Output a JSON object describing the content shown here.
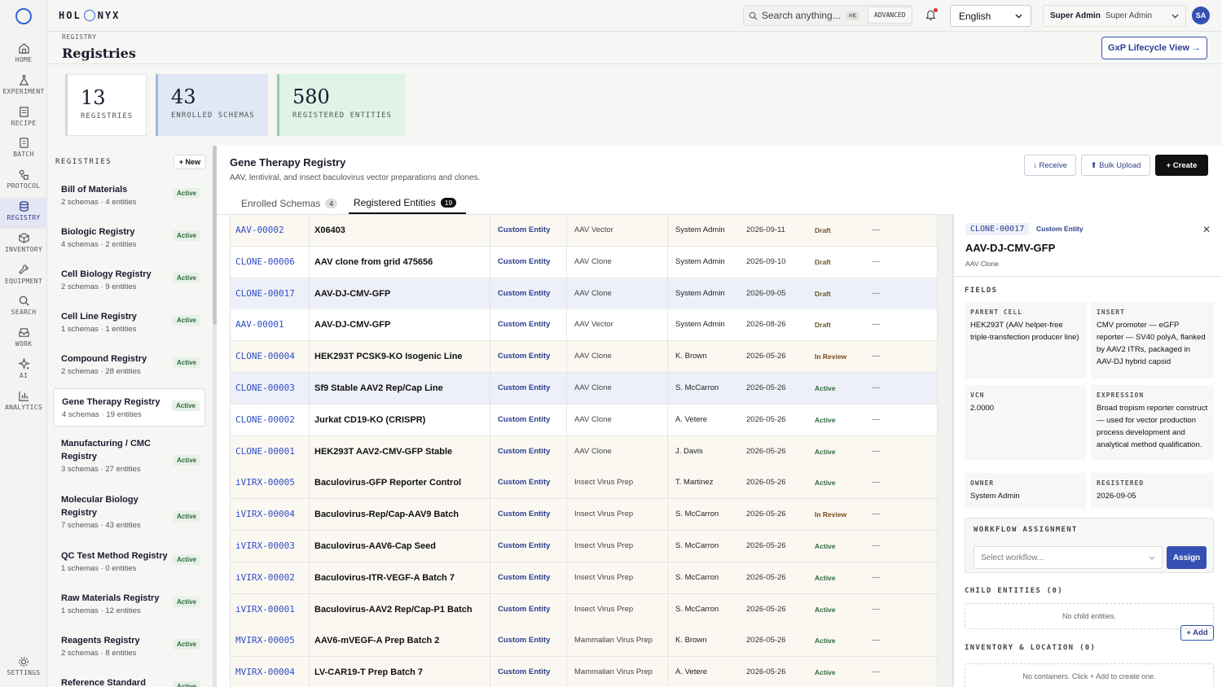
{
  "brand": {
    "left": "HOL",
    "right": "NYX"
  },
  "nav": [
    {
      "key": "home",
      "label": "HOME"
    },
    {
      "key": "experiment",
      "label": "EXPERIMENT"
    },
    {
      "key": "recipe",
      "label": "RECIPE"
    },
    {
      "key": "batch",
      "label": "BATCH"
    },
    {
      "key": "protocol",
      "label": "PROTOCOL"
    },
    {
      "key": "registry",
      "label": "REGISTRY"
    },
    {
      "key": "inventory",
      "label": "INVENTORY"
    },
    {
      "key": "equipment",
      "label": "EQUIPMENT"
    },
    {
      "key": "search",
      "label": "SEARCH"
    },
    {
      "key": "work",
      "label": "WORK"
    },
    {
      "key": "ai",
      "label": "AI"
    },
    {
      "key": "analytics",
      "label": "ANALYTICS"
    }
  ],
  "nav_settings": "SETTINGS",
  "topbar": {
    "search_placeholder": "Search anything...",
    "search_kbd": "⌘K",
    "advanced": "ADVANCED",
    "language": "English",
    "role_label": "Super Admin",
    "role_value": "Super Admin",
    "avatar": "SA"
  },
  "header": {
    "breadcrumb": "REGISTRY",
    "title": "Registries",
    "gxp_button": "GxP Lifecycle View →"
  },
  "stats": [
    {
      "value": "13",
      "label": "REGISTRIES"
    },
    {
      "value": "43",
      "label": "ENROLLED SCHEMAS"
    },
    {
      "value": "580",
      "label": "REGISTERED ENTITIES"
    }
  ],
  "registries": {
    "heading": "REGISTRIES",
    "new_button": "+ New",
    "items": [
      {
        "name": "Bill of Materials",
        "meta": "2 schemas · 4 entities",
        "status": "Active"
      },
      {
        "name": "Biologic Registry",
        "meta": "4 schemas · 2 entities",
        "status": "Active"
      },
      {
        "name": "Cell Biology Registry",
        "meta": "2 schemas · 9 entities",
        "status": "Active"
      },
      {
        "name": "Cell Line Registry",
        "meta": "1 schemas · 1 entities",
        "status": "Active"
      },
      {
        "name": "Compound Registry",
        "meta": "2 schemas · 28 entities",
        "status": "Active"
      },
      {
        "name": "Gene Therapy Registry",
        "meta": "4 schemas · 19 entities",
        "status": "Active"
      },
      {
        "name": "Manufacturing / CMC Registry",
        "meta": "3 schemas · 27 entities",
        "status": "Active"
      },
      {
        "name": "Molecular Biology Registry",
        "meta": "7 schemas · 43 entities",
        "status": "Active"
      },
      {
        "name": "QC Test Method Registry",
        "meta": "1 schemas · 0 entities",
        "status": "Active"
      },
      {
        "name": "Raw Materials Registry",
        "meta": "1 schemas · 12 entities",
        "status": "Active"
      },
      {
        "name": "Reagents Registry",
        "meta": "2 schemas · 8 entities",
        "status": "Active"
      },
      {
        "name": "Reference Standard",
        "meta": "",
        "status": "Active"
      }
    ]
  },
  "registry": {
    "title": "Gene Therapy Registry",
    "description": "AAV, lentiviral, and insect baculovirus vector preparations and clones.",
    "receive": "↓ Receive",
    "bulk_upload": "⬆ Bulk Upload",
    "create": "+ Create",
    "tabs": [
      {
        "label": "Enrolled Schemas",
        "count": "4"
      },
      {
        "label": "Registered Entities",
        "count": "19"
      }
    ]
  },
  "entities": [
    {
      "id": "AAV-00002",
      "name": "X06403",
      "type": "Custom Entity",
      "schema": "AAV Vector",
      "owner": "System Admin",
      "date": "2026-09-11",
      "status": "Draft",
      "extra": "—"
    },
    {
      "id": "CLONE-00006",
      "name": "AAV clone from grid 475656",
      "type": "Custom Entity",
      "schema": "AAV Clone",
      "owner": "System Admin",
      "date": "2026-09-10",
      "status": "Draft",
      "extra": "—"
    },
    {
      "id": "CLONE-00017",
      "name": "AAV-DJ-CMV-GFP",
      "type": "Custom Entity",
      "schema": "AAV Clone",
      "owner": "System Admin",
      "date": "2026-09-05",
      "status": "Draft",
      "extra": "—"
    },
    {
      "id": "AAV-00001",
      "name": "AAV-DJ-CMV-GFP",
      "type": "Custom Entity",
      "schema": "AAV Vector",
      "owner": "System Admin",
      "date": "2026-08-26",
      "status": "Draft",
      "extra": "—"
    },
    {
      "id": "CLONE-00004",
      "name": "HEK293T PCSK9-KO Isogenic Line",
      "type": "Custom Entity",
      "schema": "AAV Clone",
      "owner": "K. Brown",
      "date": "2026-05-26",
      "status": "In Review",
      "extra": "—"
    },
    {
      "id": "CLONE-00003",
      "name": "Sf9 Stable AAV2 Rep/Cap Line",
      "type": "Custom Entity",
      "schema": "AAV Clone",
      "owner": "S. McCarron",
      "date": "2026-05-26",
      "status": "Active",
      "extra": "—"
    },
    {
      "id": "CLONE-00002",
      "name": "Jurkat CD19-KO (CRISPR)",
      "type": "Custom Entity",
      "schema": "AAV Clone",
      "owner": "A. Vetere",
      "date": "2026-05-26",
      "status": "Active",
      "extra": "—"
    },
    {
      "id": "CLONE-00001",
      "name": "HEK293T AAV2-CMV-GFP Stable",
      "type": "Custom Entity",
      "schema": "AAV Clone",
      "owner": "J. Davis",
      "date": "2026-05-26",
      "status": "Active",
      "extra": "—"
    },
    {
      "id": "iVIRX-00005",
      "name": "Baculovirus-GFP Reporter Control",
      "type": "Custom Entity",
      "schema": "Insect Virus Prep",
      "owner": "T. Martinez",
      "date": "2026-05-26",
      "status": "Active",
      "extra": "—"
    },
    {
      "id": "iVIRX-00004",
      "name": "Baculovirus-Rep/Cap-AAV9 Batch",
      "type": "Custom Entity",
      "schema": "Insect Virus Prep",
      "owner": "S. McCarron",
      "date": "2026-05-26",
      "status": "In Review",
      "extra": "—"
    },
    {
      "id": "iVIRX-00003",
      "name": "Baculovirus-AAV6-Cap Seed",
      "type": "Custom Entity",
      "schema": "Insect Virus Prep",
      "owner": "S. McCarron",
      "date": "2026-05-26",
      "status": "Active",
      "extra": "—"
    },
    {
      "id": "iVIRX-00002",
      "name": "Baculovirus-ITR-VEGF-A Batch 7",
      "type": "Custom Entity",
      "schema": "Insect Virus Prep",
      "owner": "S. McCarron",
      "date": "2026-05-26",
      "status": "Active",
      "extra": "—"
    },
    {
      "id": "iVIRX-00001",
      "name": "Baculovirus-AAV2 Rep/Cap-P1 Batch",
      "type": "Custom Entity",
      "schema": "Insect Virus Prep",
      "owner": "S. McCarron",
      "date": "2026-05-26",
      "status": "Active",
      "extra": "—"
    },
    {
      "id": "MVIRX-00005",
      "name": "AAV6-mVEGF-A Prep Batch 2",
      "type": "Custom Entity",
      "schema": "Mammalian Virus Prep",
      "owner": "K. Brown",
      "date": "2026-05-26",
      "status": "Active",
      "extra": "—"
    },
    {
      "id": "MVIRX-00004",
      "name": "LV-CAR19-T Prep Batch 7",
      "type": "Custom Entity",
      "schema": "Mammalian Virus Prep",
      "owner": "A. Vetere",
      "date": "2026-05-26",
      "status": "Active",
      "extra": "—"
    }
  ],
  "detail": {
    "id": "CLONE-00017",
    "type": "Custom Entity",
    "title": "AAV-DJ-CMV-GFP",
    "schema": "AAV Clone",
    "close": "✕",
    "fields_heading": "FIELDS",
    "fields": [
      {
        "key": "PARENT CELL",
        "value": "HEK293T (AAV helper-free triple-transfection producer line)"
      },
      {
        "key": "INSERT",
        "value": "CMV promoter — eGFP reporter — SV40 polyA, flanked by AAV2 ITRs, packaged in AAV-DJ hybrid capsid"
      },
      {
        "key": "VCN",
        "value": "2.0000"
      },
      {
        "key": "EXPRESSION",
        "value": "Broad tropism reporter construct — used for vector production process development and analytical method qualification."
      },
      {
        "key": "OWNER",
        "value": "System Admin"
      },
      {
        "key": "REGISTERED",
        "value": "2026-09-05"
      }
    ],
    "workflow_heading": "WORKFLOW ASSIGNMENT",
    "workflow_placeholder": "Select workflow...",
    "assign": "Assign",
    "children_heading": "CHILD ENTITIES (0)",
    "children_empty": "No child entities.",
    "inventory_heading": "INVENTORY & LOCATION (0)",
    "inventory_add": "+ Add",
    "inventory_empty": "No containers. Click + Add to create one."
  }
}
